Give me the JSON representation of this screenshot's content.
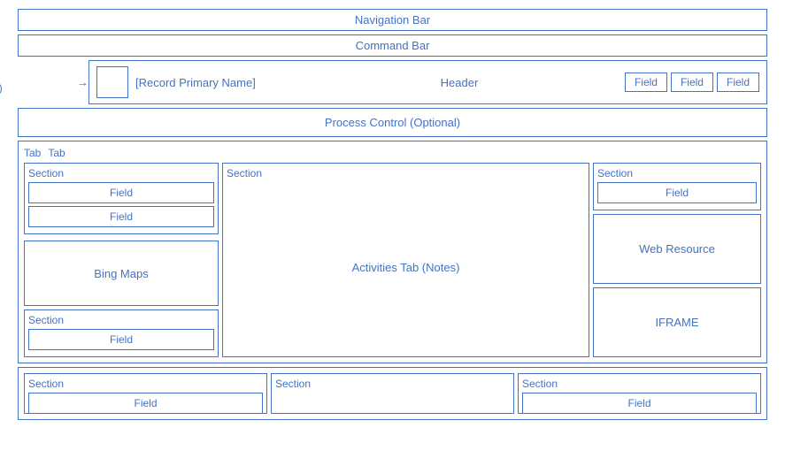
{
  "bars": {
    "navigation": "Navigation Bar",
    "command": "Command Bar"
  },
  "header": {
    "image_label": "Image\n(Optional)",
    "record_name": "[Record Primary Name]",
    "center_label": "Header",
    "fields": [
      "Field",
      "Field",
      "Field"
    ]
  },
  "process": {
    "label": "Process Control (Optional)"
  },
  "tabs": {
    "tab1": "Tab",
    "tab2": "Tab"
  },
  "left_col": {
    "section1": {
      "title": "Section",
      "fields": [
        "Field",
        "Field"
      ]
    },
    "bing_maps": "Bing Maps",
    "section2": {
      "title": "Section",
      "fields": [
        "Field"
      ]
    }
  },
  "mid_col": {
    "section_title": "Section",
    "content": "Activities Tab (Notes)"
  },
  "right_col": {
    "section_title": "Section",
    "field": "Field",
    "web_resource": "Web Resource",
    "iframe": "IFRAME"
  },
  "bottom": {
    "sections": [
      {
        "title": "Section",
        "field": "Field"
      },
      {
        "title": "Section",
        "field": ""
      },
      {
        "title": "Section",
        "field": "Field"
      }
    ]
  }
}
